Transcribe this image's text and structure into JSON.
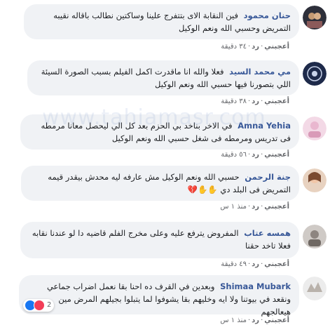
{
  "watermark": "www.tahiamasr.com",
  "comments": [
    {
      "author": "حنان محمود",
      "text": "فين النقابة الاى بتتفرج علينا وساكتين نطالب باقاله نقيبه التمريض وحسبي الله ونعم الوكيل",
      "like": "أعجبني",
      "reply": "رد",
      "time": "٣٤ دقيقة"
    },
    {
      "author": "مي محمد السيد",
      "text": "فعلا والله انا ماقدرت اكمل الفيلم بسبب الصورة السيئة اللي بتصورنا فيها حسبي الله ونعم الوكيل",
      "like": "أعجبني",
      "reply": "رد",
      "time": "٣٨ دقيقة"
    },
    {
      "author": "Amna Yehia",
      "text": "في الاخر بناخد بي الحزم بعد كل الي ليحصل معانا مرمطه فى تدريس ومرمطه فى شغل حسبي الله ونعم الوكيل",
      "like": "أعجبني",
      "reply": "رد",
      "time": "٥٦ دقيقة"
    },
    {
      "author": "جنة الرحمن",
      "text": "حسبي الله ونعم الوكيل مش عارفه ليه محدش بيقدر قيمه التمريض فى البلد دي ✋✋💔",
      "like": "أعجبني",
      "reply": "رد",
      "time": "منذ ١ س"
    },
    {
      "author": "همسه عتاب",
      "text": "المفروض يترفع عليه وعلى مخرج الفلم قاضيه دا لو عندنا نقابه فعلا تاخد حقنا",
      "like": "أعجبني",
      "reply": "رد",
      "time": "٤٩ دقيقة"
    },
    {
      "author": "Shimaa Mubark",
      "text": "وبعدين في القرف ده احنا بقا نعمل اضراب جماعي ونقعد في بيوتنا ولا ايه وخليهم بقا يشوفوا لما يتبلوا بجيلهم المرض مين هيعالجهم",
      "like": "أعجبني",
      "reply": "رد",
      "time": "منذ ١ س",
      "react_count": "2"
    }
  ]
}
